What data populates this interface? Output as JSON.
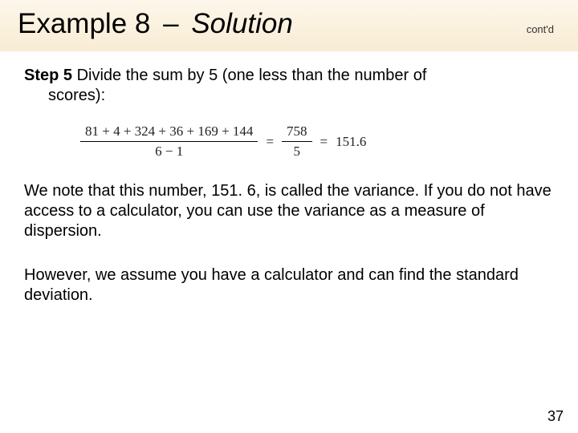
{
  "header": {
    "title_prefix": "Example 8",
    "title_dash": "–",
    "title_suffix": "Solution",
    "contd": "cont'd"
  },
  "step": {
    "label": "Step 5",
    "text_line1": " Divide the sum by 5 (one less than the number of",
    "text_line2": "scores):"
  },
  "equation": {
    "numerator_left": "81 + 4 + 324 + 36 + 169 + 144",
    "denominator_left": "6 − 1",
    "eq1": "=",
    "numerator_right": "758",
    "denominator_right": "5",
    "eq2": "=",
    "result": "151.6"
  },
  "para1": "We note that this number, 151. 6, is called the variance. If you do not have access to a calculator, you can use the variance as a measure of dispersion.",
  "para2": "However, we assume you have a calculator and can find the standard deviation.",
  "page_number": "37"
}
